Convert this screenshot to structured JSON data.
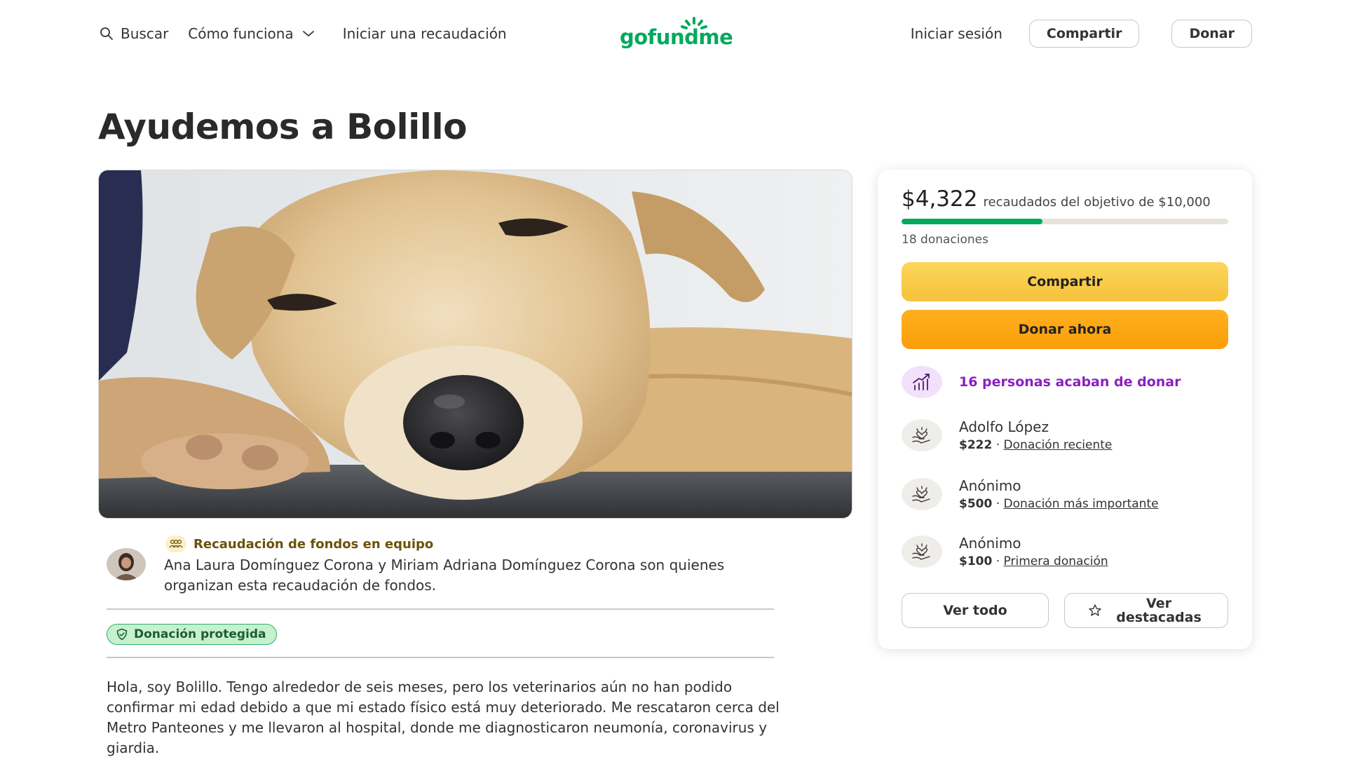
{
  "nav": {
    "search_label": "Buscar",
    "how_it_works_label": "Cómo funciona",
    "start_label": "Iniciar una recaudación",
    "logo_text": "gofundme",
    "signin_label": "Iniciar sesión",
    "share_label": "Compartir",
    "donate_label": "Donar"
  },
  "page": {
    "title": "Ayudemos a Bolillo"
  },
  "organizer": {
    "team_label": "Recaudación de fondos en equipo",
    "description": "Ana Laura Domínguez Corona y Miriam Adriana Domínguez Corona son quienes organizan esta recaudación de fondos.",
    "protected_label": "Donación protegida"
  },
  "story": {
    "text": "Hola, soy Bolillo. Tengo alrededor de seis meses, pero los veterinarios aún no han podido confirmar mi edad debido a que mi estado físico está muy deteriorado. Me rescataron cerca del Metro Panteones y me llevaron al hospital, donde me diagnosticaron neumonía, coronavirus y giardia."
  },
  "sidebar": {
    "raised_amount": "$4,322",
    "goal_text": "recaudados del objetivo de $10,000",
    "progress_fraction": 0.432,
    "donation_count": "18 donaciones",
    "share_label": "Compartir",
    "donate_now_label": "Donar ahora",
    "recent_text": "16 personas acaban de donar",
    "donors": [
      {
        "name": "Adolfo López",
        "amount": "$222",
        "tag": "Donación reciente"
      },
      {
        "name": "Anónimo",
        "amount": "$500",
        "tag": "Donación más importante"
      },
      {
        "name": "Anónimo",
        "amount": "$100",
        "tag": "Primera donación"
      }
    ],
    "see_all_label": "Ver todo",
    "see_featured_label": "Ver destacadas"
  },
  "colors": {
    "brand_green": "#02a95c",
    "share_yellow": "#f5c23b",
    "donate_orange": "#fb9e0a",
    "recent_purple": "#8b1fbf"
  }
}
